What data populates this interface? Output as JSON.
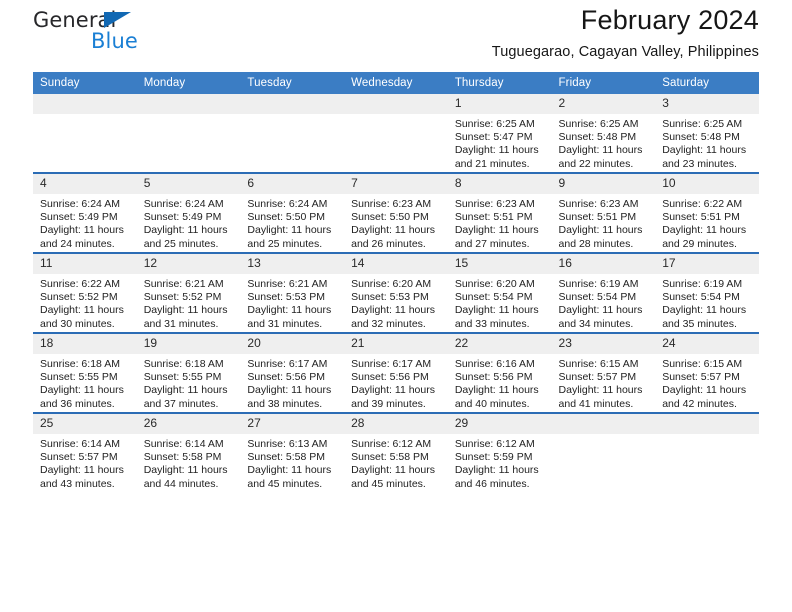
{
  "brand": {
    "name_part1": "General",
    "name_part2": "Blue",
    "triangle_color": "#1168b3",
    "blue_text_color": "#1a7fd4"
  },
  "header": {
    "title": "February 2024",
    "subtitle": "Tuguegarao, Cagayan Valley, Philippines"
  },
  "theme": {
    "header_bar_color": "#3b7dc4",
    "row_divider_color": "#2b6cb5",
    "daynum_band_color": "#efefef"
  },
  "weekday_headers": [
    "Sunday",
    "Monday",
    "Tuesday",
    "Wednesday",
    "Thursday",
    "Friday",
    "Saturday"
  ],
  "weeks": [
    [
      {
        "day": "",
        "sunrise": "",
        "sunset": "",
        "daylight": "",
        "empty": true
      },
      {
        "day": "",
        "sunrise": "",
        "sunset": "",
        "daylight": "",
        "empty": true
      },
      {
        "day": "",
        "sunrise": "",
        "sunset": "",
        "daylight": "",
        "empty": true
      },
      {
        "day": "",
        "sunrise": "",
        "sunset": "",
        "daylight": "",
        "empty": true
      },
      {
        "day": "1",
        "sunrise": "Sunrise: 6:25 AM",
        "sunset": "Sunset: 5:47 PM",
        "daylight": "Daylight: 11 hours and 21 minutes."
      },
      {
        "day": "2",
        "sunrise": "Sunrise: 6:25 AM",
        "sunset": "Sunset: 5:48 PM",
        "daylight": "Daylight: 11 hours and 22 minutes."
      },
      {
        "day": "3",
        "sunrise": "Sunrise: 6:25 AM",
        "sunset": "Sunset: 5:48 PM",
        "daylight": "Daylight: 11 hours and 23 minutes."
      }
    ],
    [
      {
        "day": "4",
        "sunrise": "Sunrise: 6:24 AM",
        "sunset": "Sunset: 5:49 PM",
        "daylight": "Daylight: 11 hours and 24 minutes."
      },
      {
        "day": "5",
        "sunrise": "Sunrise: 6:24 AM",
        "sunset": "Sunset: 5:49 PM",
        "daylight": "Daylight: 11 hours and 25 minutes."
      },
      {
        "day": "6",
        "sunrise": "Sunrise: 6:24 AM",
        "sunset": "Sunset: 5:50 PM",
        "daylight": "Daylight: 11 hours and 25 minutes."
      },
      {
        "day": "7",
        "sunrise": "Sunrise: 6:23 AM",
        "sunset": "Sunset: 5:50 PM",
        "daylight": "Daylight: 11 hours and 26 minutes."
      },
      {
        "day": "8",
        "sunrise": "Sunrise: 6:23 AM",
        "sunset": "Sunset: 5:51 PM",
        "daylight": "Daylight: 11 hours and 27 minutes."
      },
      {
        "day": "9",
        "sunrise": "Sunrise: 6:23 AM",
        "sunset": "Sunset: 5:51 PM",
        "daylight": "Daylight: 11 hours and 28 minutes."
      },
      {
        "day": "10",
        "sunrise": "Sunrise: 6:22 AM",
        "sunset": "Sunset: 5:51 PM",
        "daylight": "Daylight: 11 hours and 29 minutes."
      }
    ],
    [
      {
        "day": "11",
        "sunrise": "Sunrise: 6:22 AM",
        "sunset": "Sunset: 5:52 PM",
        "daylight": "Daylight: 11 hours and 30 minutes."
      },
      {
        "day": "12",
        "sunrise": "Sunrise: 6:21 AM",
        "sunset": "Sunset: 5:52 PM",
        "daylight": "Daylight: 11 hours and 31 minutes."
      },
      {
        "day": "13",
        "sunrise": "Sunrise: 6:21 AM",
        "sunset": "Sunset: 5:53 PM",
        "daylight": "Daylight: 11 hours and 31 minutes."
      },
      {
        "day": "14",
        "sunrise": "Sunrise: 6:20 AM",
        "sunset": "Sunset: 5:53 PM",
        "daylight": "Daylight: 11 hours and 32 minutes."
      },
      {
        "day": "15",
        "sunrise": "Sunrise: 6:20 AM",
        "sunset": "Sunset: 5:54 PM",
        "daylight": "Daylight: 11 hours and 33 minutes."
      },
      {
        "day": "16",
        "sunrise": "Sunrise: 6:19 AM",
        "sunset": "Sunset: 5:54 PM",
        "daylight": "Daylight: 11 hours and 34 minutes."
      },
      {
        "day": "17",
        "sunrise": "Sunrise: 6:19 AM",
        "sunset": "Sunset: 5:54 PM",
        "daylight": "Daylight: 11 hours and 35 minutes."
      }
    ],
    [
      {
        "day": "18",
        "sunrise": "Sunrise: 6:18 AM",
        "sunset": "Sunset: 5:55 PM",
        "daylight": "Daylight: 11 hours and 36 minutes."
      },
      {
        "day": "19",
        "sunrise": "Sunrise: 6:18 AM",
        "sunset": "Sunset: 5:55 PM",
        "daylight": "Daylight: 11 hours and 37 minutes."
      },
      {
        "day": "20",
        "sunrise": "Sunrise: 6:17 AM",
        "sunset": "Sunset: 5:56 PM",
        "daylight": "Daylight: 11 hours and 38 minutes."
      },
      {
        "day": "21",
        "sunrise": "Sunrise: 6:17 AM",
        "sunset": "Sunset: 5:56 PM",
        "daylight": "Daylight: 11 hours and 39 minutes."
      },
      {
        "day": "22",
        "sunrise": "Sunrise: 6:16 AM",
        "sunset": "Sunset: 5:56 PM",
        "daylight": "Daylight: 11 hours and 40 minutes."
      },
      {
        "day": "23",
        "sunrise": "Sunrise: 6:15 AM",
        "sunset": "Sunset: 5:57 PM",
        "daylight": "Daylight: 11 hours and 41 minutes."
      },
      {
        "day": "24",
        "sunrise": "Sunrise: 6:15 AM",
        "sunset": "Sunset: 5:57 PM",
        "daylight": "Daylight: 11 hours and 42 minutes."
      }
    ],
    [
      {
        "day": "25",
        "sunrise": "Sunrise: 6:14 AM",
        "sunset": "Sunset: 5:57 PM",
        "daylight": "Daylight: 11 hours and 43 minutes."
      },
      {
        "day": "26",
        "sunrise": "Sunrise: 6:14 AM",
        "sunset": "Sunset: 5:58 PM",
        "daylight": "Daylight: 11 hours and 44 minutes."
      },
      {
        "day": "27",
        "sunrise": "Sunrise: 6:13 AM",
        "sunset": "Sunset: 5:58 PM",
        "daylight": "Daylight: 11 hours and 45 minutes."
      },
      {
        "day": "28",
        "sunrise": "Sunrise: 6:12 AM",
        "sunset": "Sunset: 5:58 PM",
        "daylight": "Daylight: 11 hours and 45 minutes."
      },
      {
        "day": "29",
        "sunrise": "Sunrise: 6:12 AM",
        "sunset": "Sunset: 5:59 PM",
        "daylight": "Daylight: 11 hours and 46 minutes."
      },
      {
        "day": "",
        "sunrise": "",
        "sunset": "",
        "daylight": "",
        "empty": true
      },
      {
        "day": "",
        "sunrise": "",
        "sunset": "",
        "daylight": "",
        "empty": true
      }
    ]
  ]
}
